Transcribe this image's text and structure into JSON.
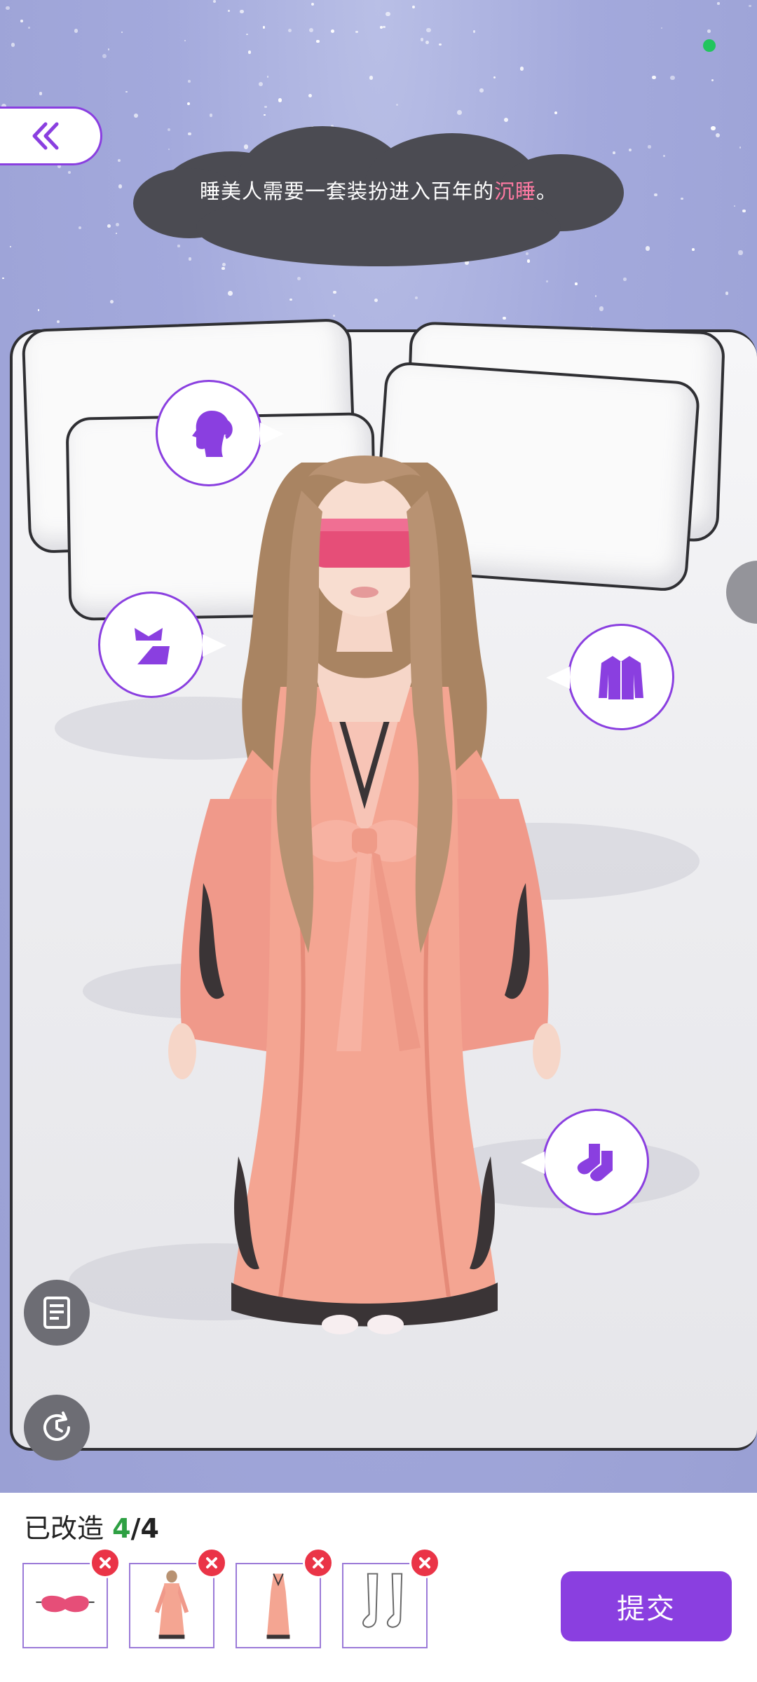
{
  "hint": {
    "before": "睡美人需要一套装扮进入百年的",
    "highlight": "沉睡",
    "after": "。",
    "highlight_color": "#ff7aa3"
  },
  "categories": [
    {
      "name": "hairstyle",
      "icon": "hair-silhouette-icon"
    },
    {
      "name": "accessory",
      "icon": "accessory-icon"
    },
    {
      "name": "top",
      "icon": "jacket-icon"
    },
    {
      "name": "socks",
      "icon": "socks-icon"
    }
  ],
  "progress": {
    "label": "已改造",
    "done": "4",
    "separator": "/",
    "total": "4"
  },
  "selected_items": [
    {
      "name": "sleep-mask",
      "icon": "sleep-mask-icon"
    },
    {
      "name": "robe",
      "icon": "robe-icon"
    },
    {
      "name": "nightgown",
      "icon": "nightgown-icon"
    },
    {
      "name": "stockings",
      "icon": "stockings-icon"
    }
  ],
  "submit_label": "提交",
  "colors": {
    "accent": "#8a3fe0",
    "remove": "#ea3447",
    "progress_done": "#2ea043"
  }
}
